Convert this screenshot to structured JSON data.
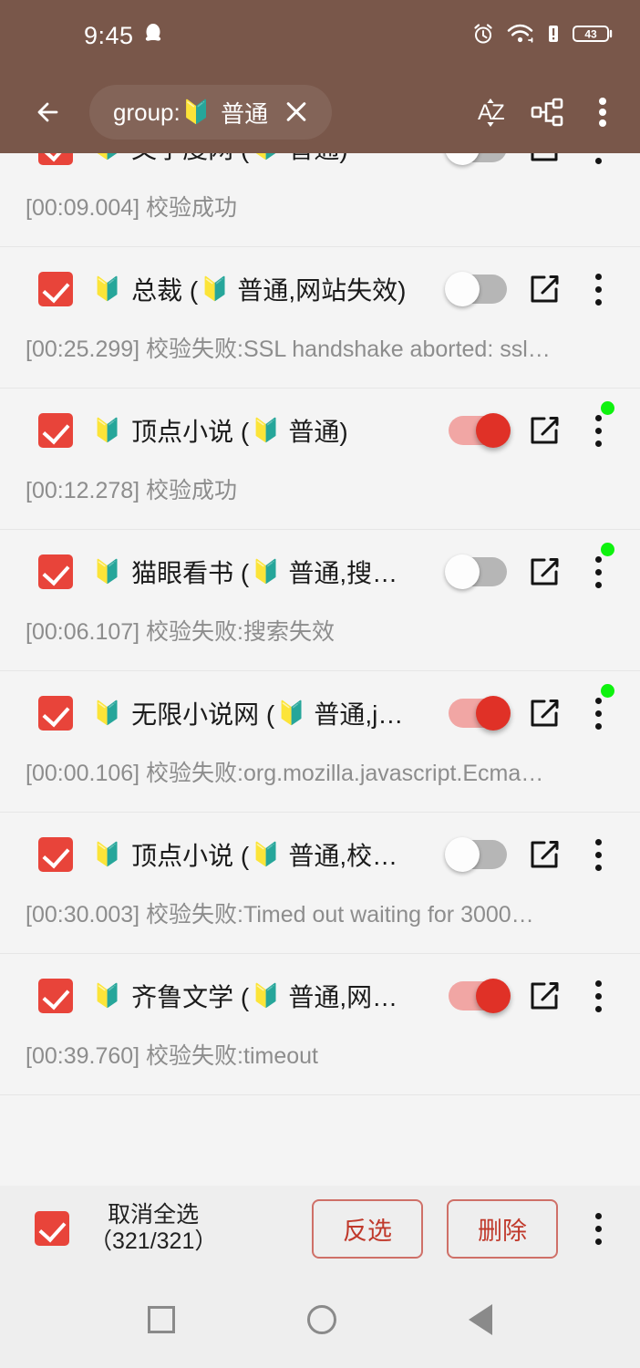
{
  "status_bar": {
    "time": "9:45",
    "battery_level": "43",
    "icons": [
      "qq-icon",
      "alarm-icon",
      "wifi-icon",
      "signal-alert-icon",
      "battery-icon"
    ]
  },
  "toolbar": {
    "back_icon": "back-arrow-icon",
    "search_chip": {
      "prefix": "group:",
      "emoji": "🔰",
      "value": "普通",
      "clear_icon": "close-icon"
    },
    "sort_icon": "sort-az-icon",
    "group_icon": "group-hierarchy-icon",
    "overflow_icon": "overflow-menu-icon"
  },
  "colors": {
    "toolbar": "#79574a",
    "background": "#f4f4f4",
    "checkbox": "#e8443a",
    "toggle_on_thumb": "#e03127",
    "toggle_on_track": "#f1a6a4",
    "toggle_off_track": "#b6b6b6",
    "status_dot": "#0ef20e",
    "accent_button": "#c0392b",
    "subtext": "#8d8d8d"
  },
  "list": {
    "rows": [
      {
        "checked": true,
        "emoji": "🔰",
        "title": "文字度网 (🔰 普通)",
        "title_text": "文字度网 (",
        "title_tail": "普通)",
        "toggle": "off",
        "status_dot": false,
        "sub": "[00:09.004] 校验成功",
        "clipped": true
      },
      {
        "checked": true,
        "emoji": "🔰",
        "title": "总裁 (🔰 普通,网站失效)",
        "title_text": "总裁 (",
        "title_tail": "普通,网站失效)",
        "toggle": "off",
        "status_dot": false,
        "sub": "[00:25.299] 校验失败:SSL handshake aborted: ssl…",
        "clipped": false
      },
      {
        "checked": true,
        "emoji": "🔰",
        "title": "顶点小说 (🔰 普通)",
        "title_text": "顶点小说 (",
        "title_tail": "普通)",
        "toggle": "on",
        "status_dot": true,
        "sub": "[00:12.278] 校验成功",
        "clipped": false
      },
      {
        "checked": true,
        "emoji": "🔰",
        "title": "猫眼看书 (🔰 普通,搜…",
        "title_text": "猫眼看书 (",
        "title_tail": "普通,搜…",
        "toggle": "off",
        "status_dot": true,
        "sub": "[00:06.107] 校验失败:搜索失效",
        "clipped": false
      },
      {
        "checked": true,
        "emoji": "🔰",
        "title": "无限小说网 (🔰 普通,j…",
        "title_text": "无限小说网 (",
        "title_tail": "普通,j…",
        "toggle": "on",
        "status_dot": true,
        "sub": "[00:00.106] 校验失败:org.mozilla.javascript.Ecma…",
        "clipped": false
      },
      {
        "checked": true,
        "emoji": "🔰",
        "title": "顶点小说 (🔰 普通,校…",
        "title_text": "顶点小说 (",
        "title_tail": "普通,校…",
        "toggle": "off",
        "status_dot": false,
        "sub": "[00:30.003] 校验失败:Timed out waiting for 3000…",
        "clipped": false
      },
      {
        "checked": true,
        "emoji": "🔰",
        "title": "齐鲁文学 (🔰 普通,网…",
        "title_text": "齐鲁文学 (",
        "title_tail": "普通,网…",
        "toggle": "on",
        "status_dot": false,
        "sub": "[00:39.760] 校验失败:timeout",
        "clipped": false
      }
    ]
  },
  "action_bar": {
    "select_all_checked": true,
    "select_all_label": "取消全选",
    "select_all_count": "（321/321）",
    "invert_label": "反选",
    "delete_label": "删除",
    "overflow_icon": "overflow-menu-icon"
  },
  "nav_bar": {
    "recents_icon": "square-recents-icon",
    "home_icon": "circle-home-icon",
    "back_icon": "triangle-back-icon"
  }
}
